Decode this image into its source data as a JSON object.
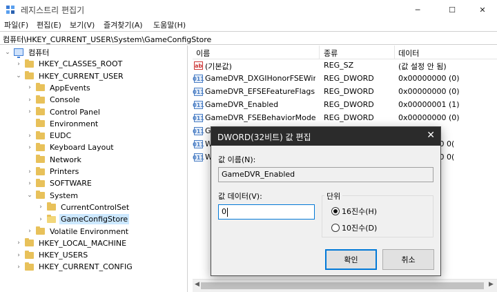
{
  "window": {
    "title": "레지스트리 편집기",
    "min_label": "─",
    "max_label": "☐",
    "close_label": "✕"
  },
  "menu": [
    "파일(F)",
    "편집(E)",
    "보기(V)",
    "즐겨찾기(A)",
    "도움말(H)"
  ],
  "address": "컴퓨터\\HKEY_CURRENT_USER\\System\\GameConfigStore",
  "tree": [
    {
      "label": "컴퓨터",
      "level": 0,
      "state": "expanded",
      "icon": "computer-icon"
    },
    {
      "label": "HKEY_CLASSES_ROOT",
      "level": 1,
      "state": "collapsed"
    },
    {
      "label": "HKEY_CURRENT_USER",
      "level": 1,
      "state": "expanded"
    },
    {
      "label": "AppEvents",
      "level": 2,
      "state": "collapsed"
    },
    {
      "label": "Console",
      "level": 2,
      "state": "collapsed"
    },
    {
      "label": "Control Panel",
      "level": 2,
      "state": "collapsed"
    },
    {
      "label": "Environment",
      "level": 2,
      "state": "leaf"
    },
    {
      "label": "EUDC",
      "level": 2,
      "state": "collapsed"
    },
    {
      "label": "Keyboard Layout",
      "level": 2,
      "state": "collapsed"
    },
    {
      "label": "Network",
      "level": 2,
      "state": "leaf"
    },
    {
      "label": "Printers",
      "level": 2,
      "state": "collapsed"
    },
    {
      "label": "SOFTWARE",
      "level": 2,
      "state": "collapsed"
    },
    {
      "label": "System",
      "level": 2,
      "state": "expanded"
    },
    {
      "label": "CurrentControlSet",
      "level": 3,
      "state": "collapsed"
    },
    {
      "label": "GameConfigStore",
      "level": 3,
      "state": "collapsed",
      "selected": true
    },
    {
      "label": "Volatile Environment",
      "level": 2,
      "state": "collapsed"
    },
    {
      "label": "HKEY_LOCAL_MACHINE",
      "level": 1,
      "state": "collapsed"
    },
    {
      "label": "HKEY_USERS",
      "level": 1,
      "state": "collapsed"
    },
    {
      "label": "HKEY_CURRENT_CONFIG",
      "level": 1,
      "state": "collapsed"
    }
  ],
  "list": {
    "columns": [
      "이름",
      "종류",
      "데이터"
    ],
    "rows": [
      {
        "icon": "string-value-icon",
        "icon_text": "ab",
        "name": "(기본값)",
        "type": "REG_SZ",
        "data": "(값 설정 안 됨)"
      },
      {
        "icon": "dword-value-icon",
        "icon_text": "011",
        "name": "GameDVR_DXGIHonorFSEWin...",
        "type": "REG_DWORD",
        "data": "0x00000000 (0)"
      },
      {
        "icon": "dword-value-icon",
        "icon_text": "011",
        "name": "GameDVR_EFSEFeatureFlags",
        "type": "REG_DWORD",
        "data": "0x00000000 (0)"
      },
      {
        "icon": "dword-value-icon",
        "icon_text": "011",
        "name": "GameDVR_Enabled",
        "type": "REG_DWORD",
        "data": "0x00000001 (1)"
      },
      {
        "icon": "dword-value-icon",
        "icon_text": "011",
        "name": "GameDVR_FSEBehaviorMode",
        "type": "REG_DWORD",
        "data": "0x00000000 (0)"
      },
      {
        "icon": "dword-value-icon",
        "icon_text": "011",
        "name": "G",
        "type": "",
        "data": "(0)"
      },
      {
        "icon": "dword-value-icon",
        "icon_text": "011",
        "name": "W",
        "type": "",
        "data": "00 00 00 00 0("
      },
      {
        "icon": "dword-value-icon",
        "icon_text": "011",
        "name": "W",
        "type": "",
        "data": "00 00 00 00 0("
      }
    ]
  },
  "dialog": {
    "title": "DWORD(32비트) 값 편집",
    "close_label": "✕",
    "name_label": "값 이름(N):",
    "name_value": "GameDVR_Enabled",
    "data_label": "값 데이터(V):",
    "data_value": "0",
    "base_label": "단위",
    "radio_hex": "16진수(H)",
    "radio_dec": "10진수(D)",
    "ok_label": "확인",
    "cancel_label": "취소"
  },
  "scroll": {
    "left_arrow": "◀",
    "right_arrow": "▶"
  }
}
